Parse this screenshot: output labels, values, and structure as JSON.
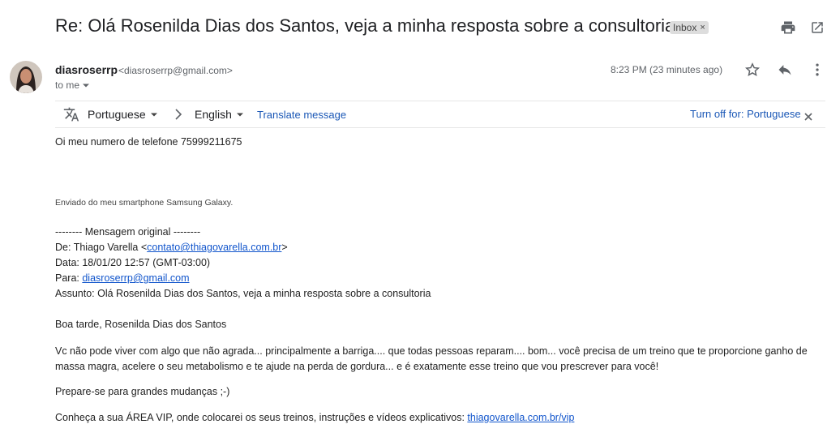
{
  "subject": "Re: Olá Rosenilda Dias dos Santos, veja a minha resposta sobre a consultoria",
  "label": {
    "text": "Inbox",
    "remove": "×"
  },
  "sender": {
    "name": "diasroserrp",
    "email": "<diasroserrp@gmail.com>"
  },
  "to": "to me",
  "time": "8:23 PM (23 minutes ago)",
  "translate": {
    "from_lang": "Portuguese",
    "to_lang": "English",
    "translate_link": "Translate message",
    "turn_off": "Turn off for: Portuguese"
  },
  "message": {
    "line1": "Oi meu numero de telefone 75999211675",
    "signature": "Enviado do meu smartphone Samsung Galaxy.",
    "orig_header": "-------- Mensagem original --------",
    "from_label": "De: Thiago Varella <",
    "from_email": "contato@thiagovarella.com.br",
    "from_end": ">",
    "date_line": "Data: 18/01/20 12:57 (GMT-03:00)",
    "to_label": "Para: ",
    "to_email": "diasroserrp@gmail.com",
    "subject_line": "Assunto: Olá Rosenilda Dias dos Santos, veja a minha resposta sobre a consultoria",
    "greeting": "Boa tarde, Rosenilda Dias dos Santos",
    "para1": "Vc não pode viver com algo que não agrada... principalmente a barriga.... que todas pessoas reparam.... bom... você precisa de um treino que te proporcione ganho de massa magra, acelere o seu metabolismo e te ajude na perda de gordura... e é exatamente esse treino que vou prescrever para você!",
    "para2": "Prepare-se para grandes mudanças ;-)",
    "para3_text": "Conheça a sua ÁREA VIP, onde colocarei os seus treinos, instruções e vídeos explicativos: ",
    "para3_link": "thiagovarella.com.br/vip"
  },
  "icons": {
    "print": "print-icon",
    "popout": "open-in-new-window-icon",
    "star": "star-icon",
    "reply": "reply-icon",
    "more": "more-vert-icon",
    "translate": "translate-icon"
  },
  "colors": {
    "link": "#1155cc",
    "accent_blue": "#1a57b6"
  }
}
